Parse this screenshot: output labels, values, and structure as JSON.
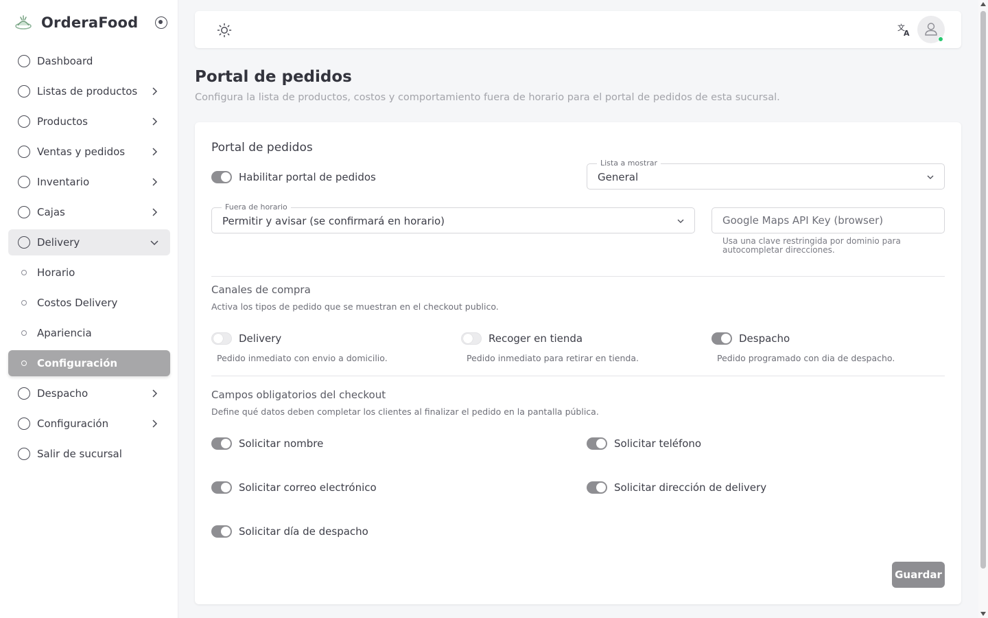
{
  "sidebar": {
    "brand": "OrderaFood",
    "items": [
      {
        "label": "Dashboard"
      },
      {
        "label": "Listas de productos"
      },
      {
        "label": "Productos"
      },
      {
        "label": "Ventas y pedidos"
      },
      {
        "label": "Inventario"
      },
      {
        "label": "Cajas"
      },
      {
        "label": "Delivery"
      },
      {
        "label": "Horario"
      },
      {
        "label": "Costos Delivery"
      },
      {
        "label": "Apariencia"
      },
      {
        "label": "Configuración"
      },
      {
        "label": "Despacho"
      },
      {
        "label": "Configuración"
      },
      {
        "label": "Salir de sucursal"
      }
    ]
  },
  "header": {
    "translate_icon": "translate-icon",
    "theme_icon": "sun-icon"
  },
  "page": {
    "title": "Portal de pedidos",
    "subtitle": "Configura la lista de productos, costos y comportamiento fuera de horario para el portal de pedidos de esta sucursal."
  },
  "card": {
    "title": "Portal de pedidos",
    "enable_label": "Habilitar portal de pedidos",
    "enable_on": true,
    "list_label": "Lista a mostrar",
    "list_value": "General",
    "after_hours_label": "Fuera de horario",
    "after_hours_value": "Permitir y avisar (se confirmará en horario)",
    "maps_placeholder": "Google Maps API Key (browser)",
    "maps_helper": "Usa una clave restringida por dominio para autocompletar direcciones.",
    "channels": {
      "title": "Canales de compra",
      "description": "Activa los tipos de pedido que se muestran en el checkout publico.",
      "options": [
        {
          "label": "Delivery",
          "desc": "Pedido inmediato con envio a domicilio.",
          "on": false
        },
        {
          "label": "Recoger en tienda",
          "desc": "Pedido inmediato para retirar en tienda.",
          "on": false
        },
        {
          "label": "Despacho",
          "desc": "Pedido programado con dia de despacho.",
          "on": true
        }
      ]
    },
    "required": {
      "title": "Campos obligatorios del checkout",
      "description": "Define qué datos deben completar los clientes al finalizar el pedido en la pantalla pública.",
      "fields": [
        {
          "label": "Solicitar nombre",
          "on": true
        },
        {
          "label": "Solicitar teléfono",
          "on": true
        },
        {
          "label": "Solicitar correo electrónico",
          "on": true
        },
        {
          "label": "Solicitar dirección de delivery",
          "on": true
        },
        {
          "label": "Solicitar día de despacho",
          "on": true
        }
      ]
    },
    "save_label": "Guardar"
  },
  "colors": {
    "toggle_on": "#8e8e92",
    "active_nav": "#a7a7a9",
    "status_online": "#28c76f"
  }
}
